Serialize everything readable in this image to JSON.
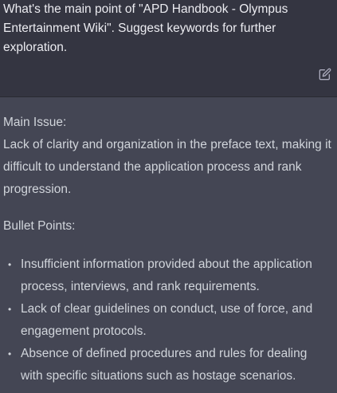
{
  "conversation": {
    "user_message": "What's the main point of \"APD Handbook - Olympus Entertainment Wiki\". Suggest keywords for further exploration.",
    "edit_icon": "edit-icon",
    "assistant": {
      "main_issue_heading": "Main Issue:",
      "main_issue_text": "Lack of clarity and organization in the preface text, making it difficult to understand the application process and rank progression.",
      "bullet_points_heading": "Bullet Points:",
      "bullet_marker": "•",
      "bullets": [
        "Insufficient information provided about the application process, interviews, and rank requirements.",
        "Lack of clear guidelines on conduct, use of force, and engagement protocols.",
        "Absence of defined procedures and rules for dealing with specific situations such as hostage scenarios."
      ]
    }
  },
  "colors": {
    "user_bg": "#343541",
    "assistant_bg": "#444654",
    "text": "#d1d5db",
    "icon": "#acacbe"
  }
}
